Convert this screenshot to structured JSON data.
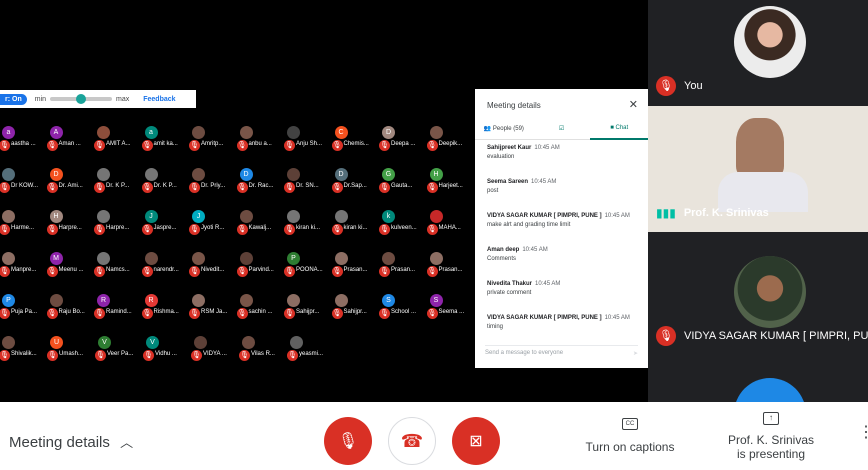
{
  "caption_bar": {
    "status": "r: On",
    "min": "min",
    "max": "max",
    "feedback": "Feedback",
    "level_fraction": 0.5
  },
  "participants": [
    [
      {
        "n": "aastha ...",
        "c": "#8e24aa",
        "i": "a"
      },
      {
        "n": "Aman ...",
        "c": "#8e24aa",
        "i": "A"
      },
      {
        "n": "AMIT A...",
        "c": "#8d4e3b",
        "i": ""
      },
      {
        "n": "amit ka...",
        "c": "#00897b",
        "i": "a"
      },
      {
        "n": "Amritp...",
        "c": "#6d4c41",
        "i": ""
      },
      {
        "n": "anbu a...",
        "c": "#795548",
        "i": ""
      },
      {
        "n": "Anju Sh...",
        "c": "#424242",
        "i": ""
      },
      {
        "n": "Chemis...",
        "c": "#f4511e",
        "i": "C"
      },
      {
        "n": "Deepa ...",
        "c": "#a1887f",
        "i": "D"
      },
      {
        "n": "Deepik...",
        "c": "#795548",
        "i": ""
      }
    ],
    [
      {
        "n": "Dr KOW...",
        "c": "#546e7a",
        "i": ""
      },
      {
        "n": "Dr. Ami...",
        "c": "#f4511e",
        "i": "D"
      },
      {
        "n": "Dr. K P...",
        "c": "#757575",
        "i": ""
      },
      {
        "n": "Dr. K P...",
        "c": "#757575",
        "i": ""
      },
      {
        "n": "Dr. Priy...",
        "c": "#6d4c41",
        "i": ""
      },
      {
        "n": "Dr. Rac...",
        "c": "#1e88e5",
        "i": "D"
      },
      {
        "n": "Dr. SN...",
        "c": "#5d4037",
        "i": ""
      },
      {
        "n": "Dr.Sap...",
        "c": "#546e7a",
        "i": "D"
      },
      {
        "n": "Gauta...",
        "c": "#43a047",
        "i": "G"
      },
      {
        "n": "Harjeet...",
        "c": "#43a047",
        "i": "H"
      }
    ],
    [
      {
        "n": "Harme...",
        "c": "#8d6e63",
        "i": ""
      },
      {
        "n": "Harpre...",
        "c": "#a1887f",
        "i": "H"
      },
      {
        "n": "Harpre...",
        "c": "#757575",
        "i": ""
      },
      {
        "n": "Jaspre...",
        "c": "#00897b",
        "i": "J"
      },
      {
        "n": "Jyoti R...",
        "c": "#00acc1",
        "i": "J"
      },
      {
        "n": "Kawalj...",
        "c": "#6d4c41",
        "i": ""
      },
      {
        "n": "kiran ki...",
        "c": "#757575",
        "i": ""
      },
      {
        "n": "kiran ki...",
        "c": "#757575",
        "i": ""
      },
      {
        "n": "kulveen...",
        "c": "#00897b",
        "i": "k"
      },
      {
        "n": "MAHA...",
        "c": "#c62828",
        "i": ""
      }
    ],
    [
      {
        "n": "Manpre...",
        "c": "#8d6e63",
        "i": ""
      },
      {
        "n": "Meenu ...",
        "c": "#8e24aa",
        "i": "M"
      },
      {
        "n": "Namcs...",
        "c": "#757575",
        "i": ""
      },
      {
        "n": "narendr...",
        "c": "#6d4c41",
        "i": ""
      },
      {
        "n": "Nivedit...",
        "c": "#795548",
        "i": ""
      },
      {
        "n": "Parvind...",
        "c": "#5d4037",
        "i": ""
      },
      {
        "n": "POONA...",
        "c": "#2e7d32",
        "i": "P"
      },
      {
        "n": "Prasan...",
        "c": "#8d6e63",
        "i": ""
      },
      {
        "n": "Prasan...",
        "c": "#6d4c41",
        "i": ""
      },
      {
        "n": "Prasan...",
        "c": "#8d6e63",
        "i": ""
      }
    ],
    [
      {
        "n": "Puja Pa...",
        "c": "#1e88e5",
        "i": "P"
      },
      {
        "n": "Raju Bo...",
        "c": "#6d4c41",
        "i": ""
      },
      {
        "n": "Ramind...",
        "c": "#8e24aa",
        "i": "R"
      },
      {
        "n": "Rishma...",
        "c": "#e53935",
        "i": "R"
      },
      {
        "n": "RSM Ja...",
        "c": "#8d6e63",
        "i": ""
      },
      {
        "n": "sachin ...",
        "c": "#795548",
        "i": ""
      },
      {
        "n": "Sahijpr...",
        "c": "#8d6e63",
        "i": ""
      },
      {
        "n": "Sahijpr...",
        "c": "#8d6e63",
        "i": ""
      },
      {
        "n": "School ...",
        "c": "#1e88e5",
        "i": "S"
      },
      {
        "n": "Seema ...",
        "c": "#8e24aa",
        "i": "S"
      }
    ],
    [
      {
        "n": "Shivalik...",
        "c": "#6d4c41",
        "i": ""
      },
      {
        "n": "Umash...",
        "c": "#f4511e",
        "i": "U"
      },
      {
        "n": "Veer Pa...",
        "c": "#2e7d32",
        "i": "V"
      },
      {
        "n": "Vidhu ...",
        "c": "#00897b",
        "i": "V"
      },
      {
        "n": "VIDYA ...",
        "c": "#5d4037",
        "i": ""
      },
      {
        "n": "Vilas R...",
        "c": "#6d4c41",
        "i": ""
      },
      {
        "n": "yeasmi...",
        "c": "#616161",
        "i": ""
      }
    ]
  ],
  "panel": {
    "title": "Meeting details",
    "tab_people": "People (59)",
    "tab_chat": "Chat",
    "messages": [
      {
        "who": "Sahijpreet Kaur",
        "time": "10:45 AM",
        "text": "evaluation"
      },
      {
        "who": "Seema Sareen",
        "time": "10:45 AM",
        "text": "post"
      },
      {
        "who": "VIDYA SAGAR KUMAR [ PIMPRI, PUNE ]",
        "time": "10:45 AM",
        "text": "make alrt and grading time limit"
      },
      {
        "who": "Aman deep",
        "time": "10:45 AM",
        "text": "Comments"
      },
      {
        "who": "Nivedita Thakur",
        "time": "10:45 AM",
        "text": "private comment"
      },
      {
        "who": "VIDYA SAGAR KUMAR [ PIMPRI, PUNE ]",
        "time": "10:45 AM",
        "text": "timing"
      }
    ],
    "placeholder": "Send a message to everyone"
  },
  "side_tiles": {
    "you": "You",
    "speaker": "Prof. K. Srinivas",
    "third": "VIDYA SAGAR KUMAR [ PIMPRI, PUNE ]"
  },
  "bottom": {
    "meeting_details": "Meeting details",
    "captions_label": "Turn on captions",
    "presenting_line1": "Prof. K. Srinivas",
    "presenting_line2": "is presenting"
  },
  "colors": {
    "end_call": "#d93025",
    "mic_off": "#d93025",
    "speaking": "#00bfa5"
  }
}
